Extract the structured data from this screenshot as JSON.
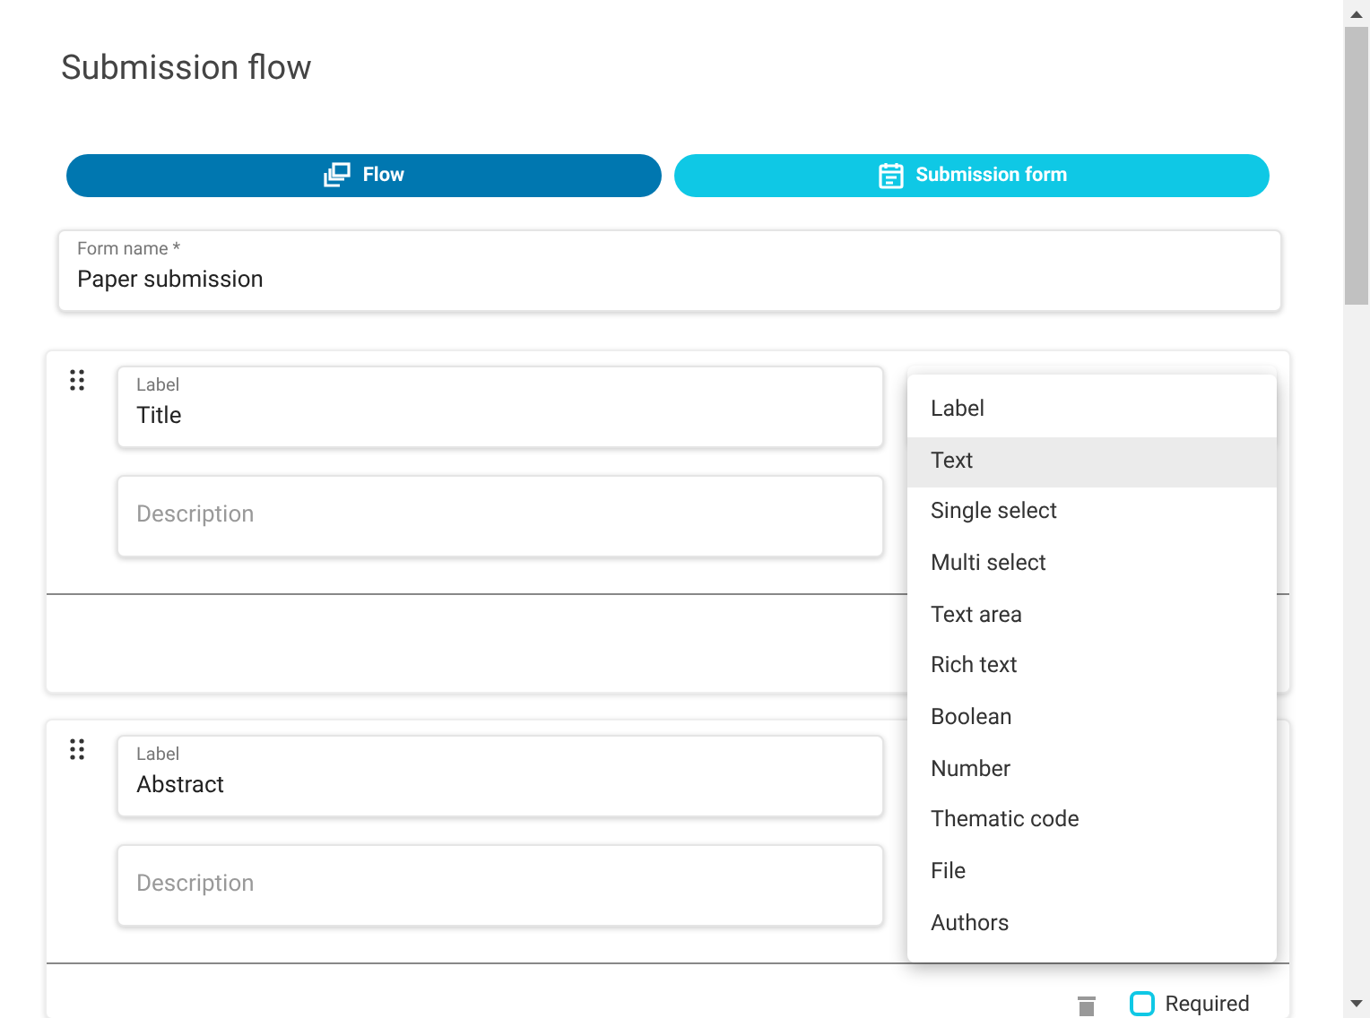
{
  "title": "Submission flow",
  "tabs": [
    {
      "label": "Flow",
      "kind": "flow",
      "selected": true
    },
    {
      "label": "Submission form",
      "kind": "form",
      "selected": false
    }
  ],
  "form_name": {
    "label": "Form name *",
    "value": "Paper submission"
  },
  "fields": [
    {
      "label_field": {
        "label": "Label",
        "value": "Title"
      },
      "description": {
        "placeholder": "Description"
      }
    },
    {
      "label_field": {
        "label": "Label",
        "value": "Abstract"
      },
      "description": {
        "placeholder": "Description"
      },
      "footer": {
        "required": {
          "label": "Required",
          "checked": false
        }
      }
    }
  ],
  "type_menu": {
    "items": [
      {
        "label": "Label",
        "selected": false
      },
      {
        "label": "Text",
        "selected": true
      },
      {
        "label": "Single select",
        "selected": false
      },
      {
        "label": "Multi select",
        "selected": false
      },
      {
        "label": "Text area",
        "selected": false
      },
      {
        "label": "Rich text",
        "selected": false
      },
      {
        "label": "Boolean",
        "selected": false
      },
      {
        "label": "Number",
        "selected": false
      },
      {
        "label": "Thematic code",
        "selected": false
      },
      {
        "label": "File",
        "selected": false
      },
      {
        "label": "Authors",
        "selected": false
      }
    ]
  }
}
